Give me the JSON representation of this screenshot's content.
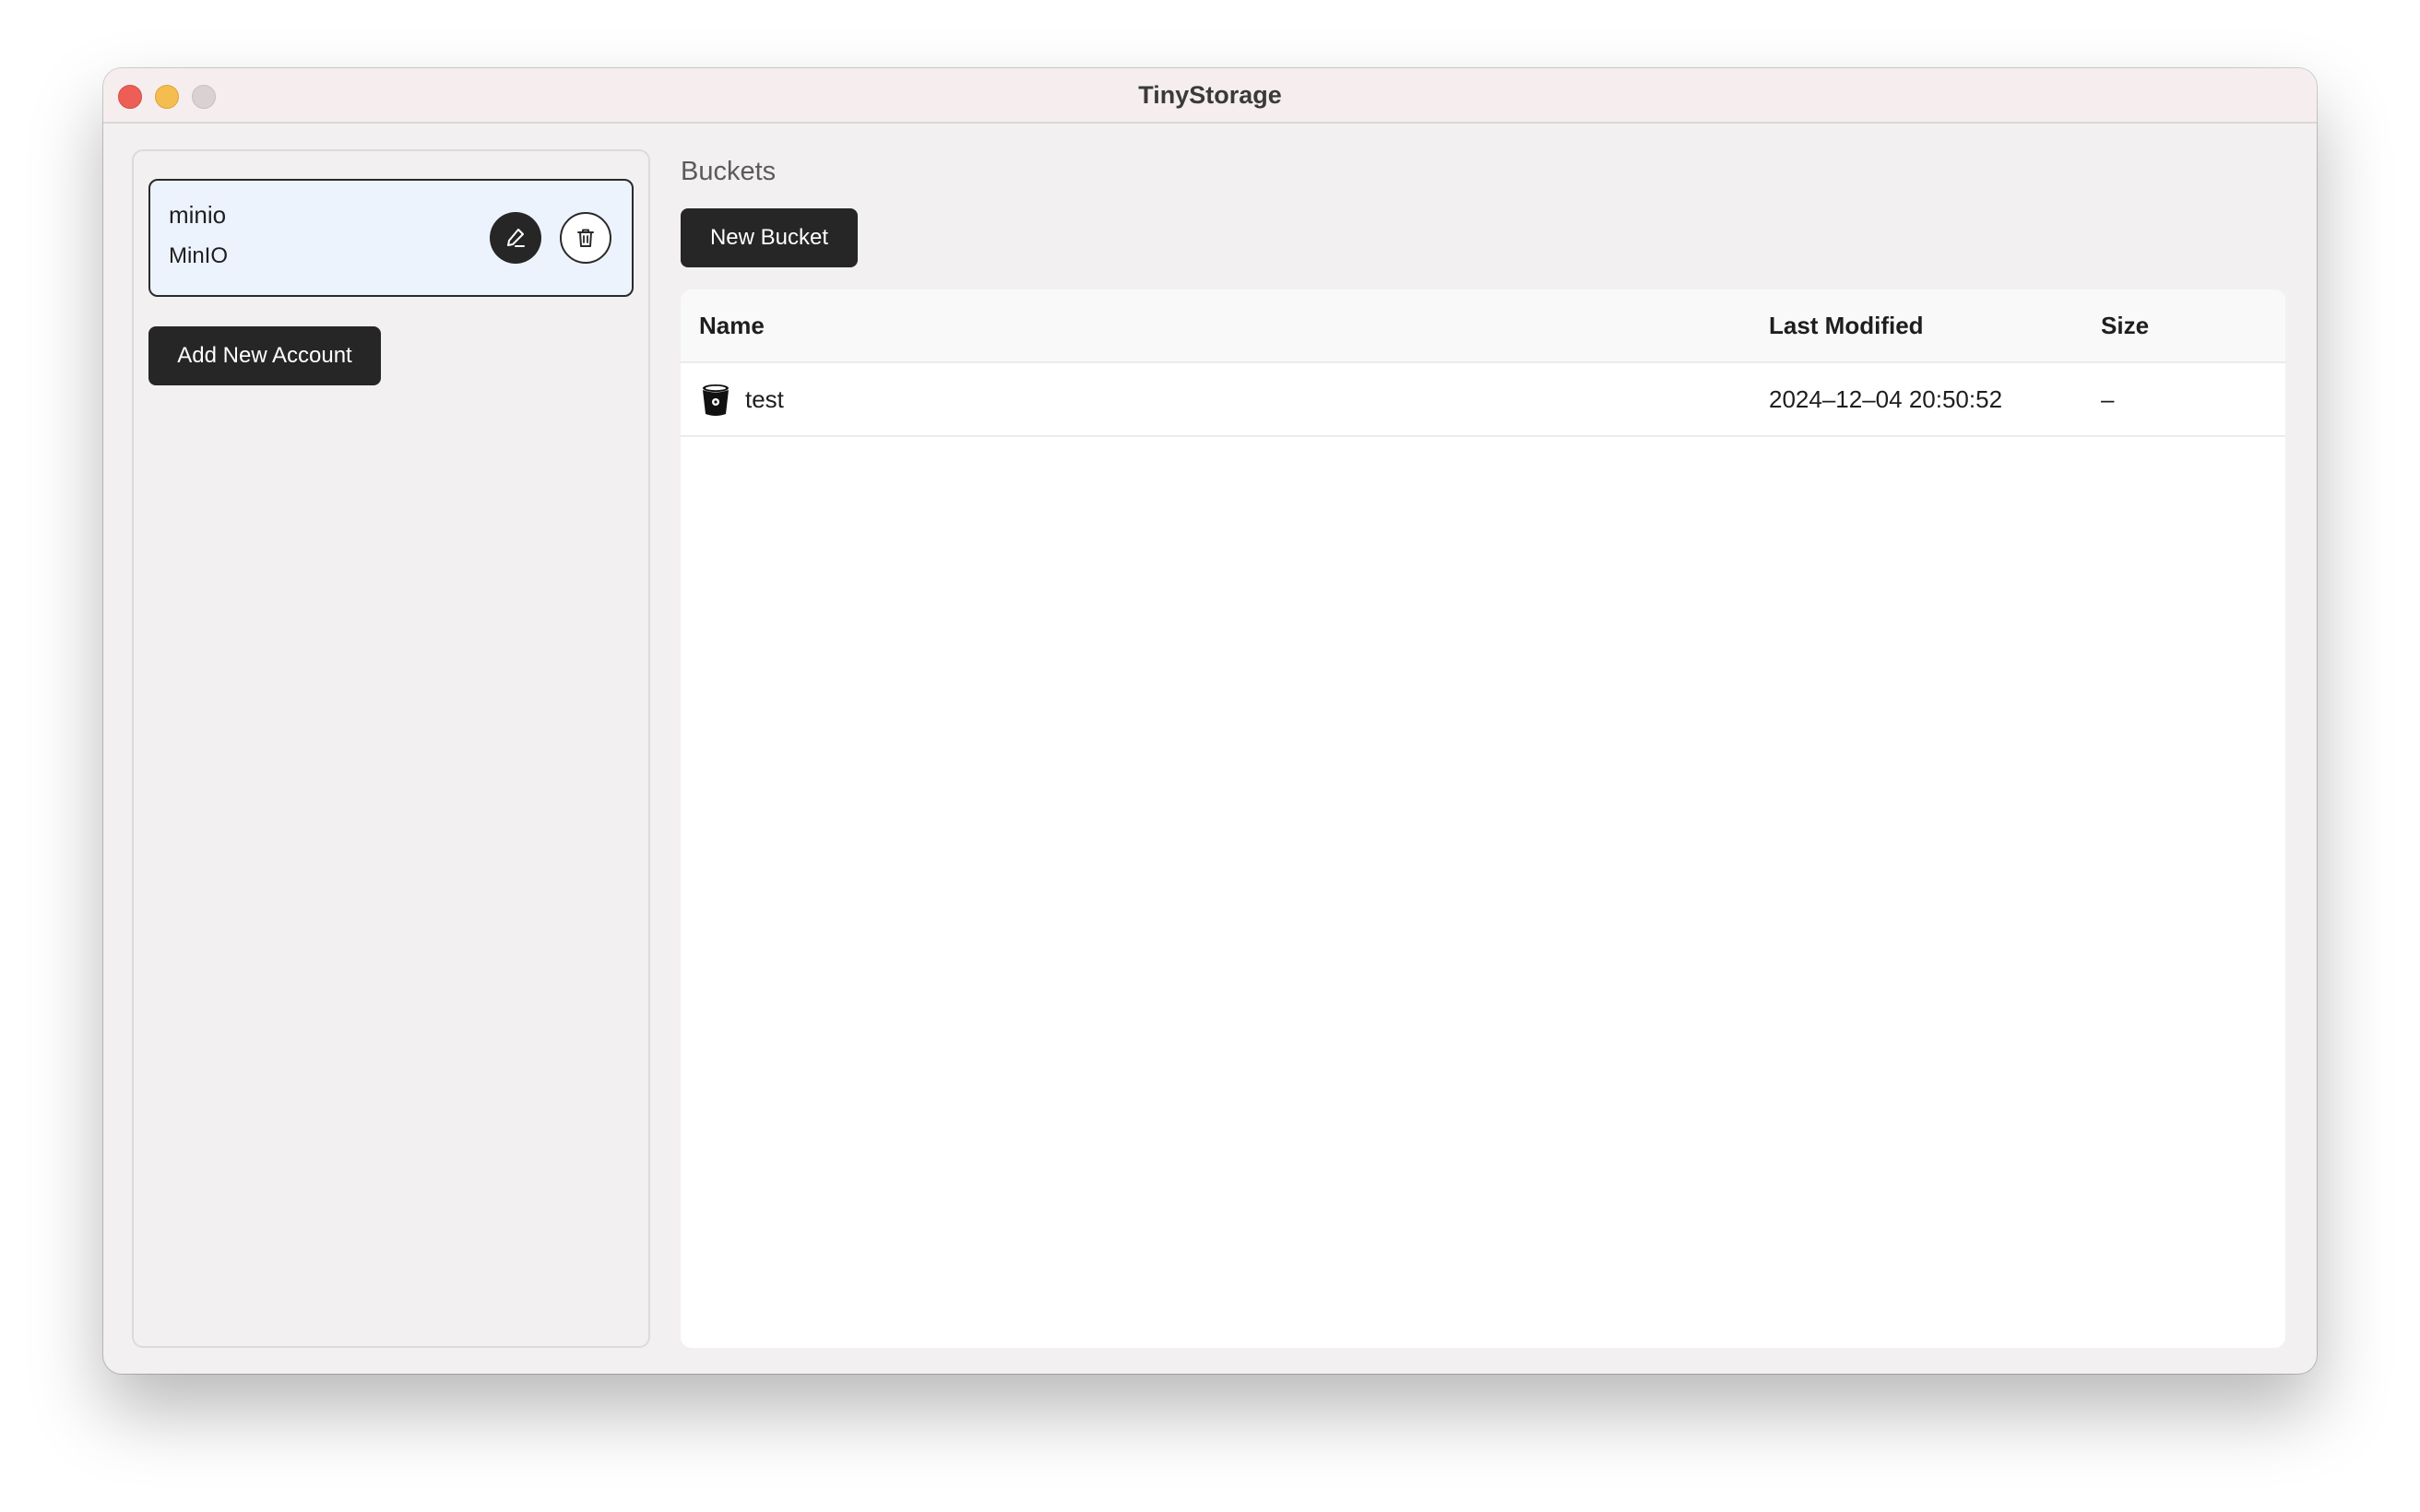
{
  "window": {
    "title": "TinyStorage"
  },
  "sidebar": {
    "accounts": [
      {
        "name": "minio",
        "type": "MinIO",
        "edit_icon": "pencil-icon",
        "delete_icon": "trash-icon"
      }
    ],
    "add_account_label": "Add New Account"
  },
  "main": {
    "section_title": "Buckets",
    "new_bucket_label": "New Bucket",
    "table": {
      "columns": [
        "Name",
        "Last Modified",
        "Size"
      ],
      "rows": [
        {
          "icon": "bucket-icon",
          "name": "test",
          "last_modified": "2024–12–04 20:50:52",
          "size": "–"
        }
      ]
    }
  },
  "colors": {
    "accent_dark": "#262626",
    "selected_card": "#edf3fd"
  }
}
